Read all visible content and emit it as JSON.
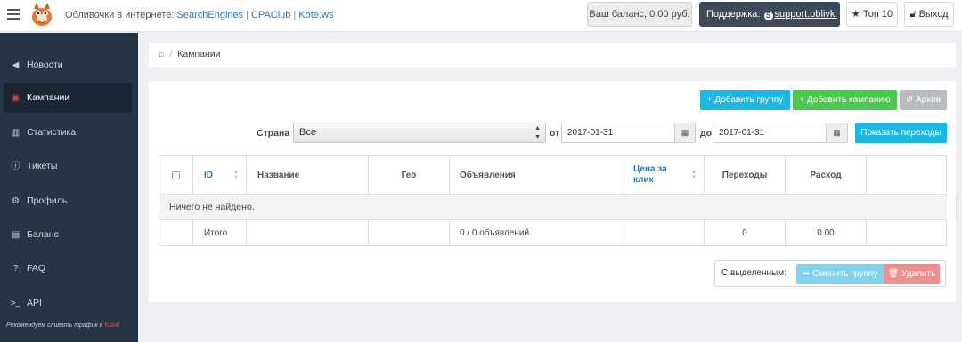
{
  "header": {
    "partners_label": "Обливочки в интернете:",
    "partners": [
      "SearchEngines",
      "CPAClub",
      "Kote.ws"
    ],
    "balance": "Ваш баланс, 0.00 руб.",
    "support_label": "Поддержка:",
    "support_link": "support.oblivki",
    "top10": "Топ 10",
    "logout": "Выход"
  },
  "sidebar": {
    "items": [
      {
        "label": "Новости",
        "icon": "megaphone-icon",
        "glyph": "✉"
      },
      {
        "label": "Кампании",
        "icon": "image-icon",
        "glyph": "▣"
      },
      {
        "label": "Статистика",
        "icon": "bar-chart-icon",
        "glyph": "▥"
      },
      {
        "label": "Тикеты",
        "icon": "info-icon",
        "glyph": "ℹ"
      },
      {
        "label": "Профиль",
        "icon": "cogs-icon",
        "glyph": "⚙"
      },
      {
        "label": "Баланс",
        "icon": "money-icon",
        "glyph": "▤"
      },
      {
        "label": "FAQ",
        "icon": "question-icon",
        "glyph": "?"
      },
      {
        "label": "API",
        "icon": "terminal-icon",
        "glyph": ">_"
      }
    ],
    "active": "Кампании",
    "promo_prefix": "Рекомендуем сливать трафик в ",
    "promo_brand": "KMA!"
  },
  "breadcrumb": {
    "current": "Кампании"
  },
  "toolbar": {
    "add_group": "Добавить группу",
    "add_campaign": "Добавить кампанию",
    "archive": "Архив"
  },
  "filters": {
    "country_label": "Страна",
    "country_value": "Все",
    "from_label": "от",
    "from_value": "2017-01-31",
    "to_label": "до",
    "to_value": "2017-01-31",
    "show_button": "Показать переходы"
  },
  "table": {
    "headers": [
      "ID",
      "Название",
      "Гео",
      "Объявления",
      "Цена за клик",
      "Переходы",
      "Расход"
    ],
    "empty_message": "Ничего не найдено.",
    "total": {
      "label": "Итого",
      "ads": "0 / 0 объявлений",
      "clicks": "0",
      "spend": "0.00"
    }
  },
  "bulk": {
    "label": "С выделенным:",
    "change_group": "Сменить группу",
    "delete": "Удалить"
  },
  "colors": {
    "sidebar_bg": "#263544",
    "primary": "#1cb8e4",
    "success": "#4bc84e",
    "danger": "#f28d8d",
    "support_bg": "#3e4a5a"
  }
}
